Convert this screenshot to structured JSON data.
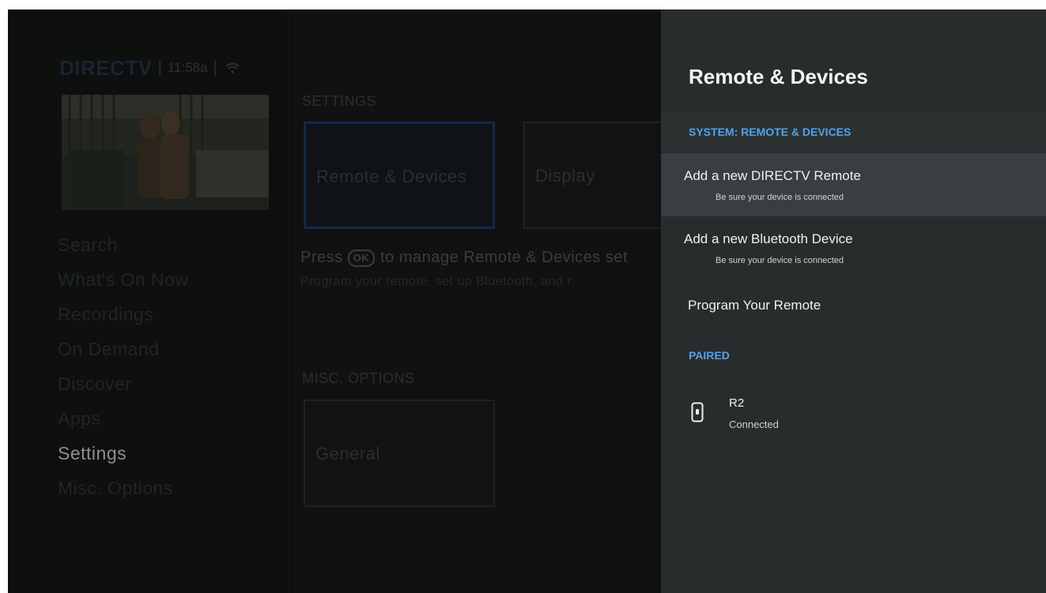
{
  "nav": {
    "brand": "DIRECTV",
    "separator": "|",
    "time": "11:58a",
    "wifi_icon": "wifi-icon",
    "items": [
      {
        "label": "Search"
      },
      {
        "label": "What's On Now"
      },
      {
        "label": "Recordings"
      },
      {
        "label": "On Demand"
      },
      {
        "label": "Discover"
      },
      {
        "label": "Apps"
      },
      {
        "label": "Settings",
        "active": true
      },
      {
        "label": "Misc. Options"
      }
    ]
  },
  "settings": {
    "section_title": "SETTINGS",
    "tiles": [
      "Remote & Devices",
      "Display"
    ],
    "hint_press": "Press",
    "hint_ok": "OK",
    "hint_rest": "to manage Remote & Devices set",
    "hint_line2": "Program your remote, set up Bluetooth, and r",
    "misc_title": "MISC. OPTIONS",
    "misc_tile": "General"
  },
  "panel": {
    "title": "Remote & Devices",
    "section_system": "SYSTEM: REMOTE & DEVICES",
    "items": [
      {
        "label": "Add a new DIRECTV Remote",
        "sub": "Be sure your device is connected"
      },
      {
        "label": "Add a new Bluetooth Device",
        "sub": "Be sure your device is connected"
      },
      {
        "label": "Program Your Remote"
      }
    ],
    "section_paired": "PAIRED",
    "device": {
      "icon": "remote-control-icon",
      "name": "R2",
      "status": "Connected"
    }
  },
  "colors": {
    "accent_blue": "#4fa3ec",
    "panel_bg": "#292c2d",
    "selected_row": "#3a3e40",
    "background": "#101111"
  }
}
